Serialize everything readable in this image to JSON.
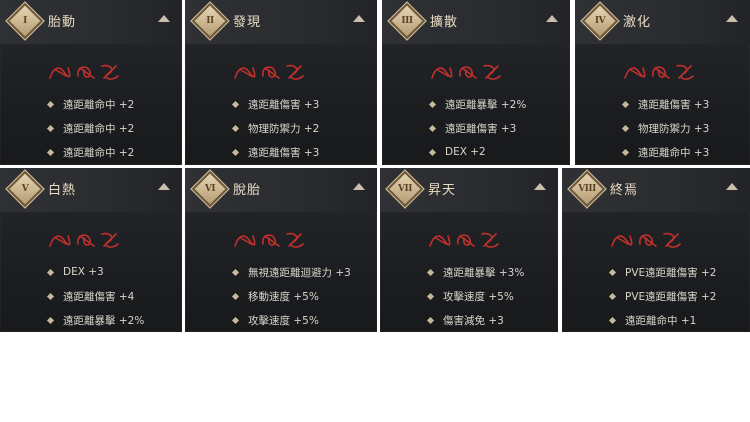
{
  "panels": [
    {
      "numeral": "I",
      "title": "胎動",
      "stats": [
        "遠距離命中 +2",
        "遠距離命中 +2",
        "遠距離命中 +2"
      ]
    },
    {
      "numeral": "II",
      "title": "發現",
      "stats": [
        "遠距離傷害 +3",
        "物理防禦力 +2",
        "遠距離傷害 +3"
      ]
    },
    {
      "numeral": "III",
      "title": "擴散",
      "stats": [
        "遠距離暴擊 +2%",
        "遠距離傷害 +3",
        "DEX +2"
      ]
    },
    {
      "numeral": "IV",
      "title": "激化",
      "stats": [
        "遠距離傷害 +3",
        "物理防禦力 +3",
        "遠距離命中 +3"
      ]
    },
    {
      "numeral": "V",
      "title": "白熱",
      "stats": [
        "DEX +3",
        "遠距離傷害 +4",
        "遠距離暴擊 +2%"
      ]
    },
    {
      "numeral": "VI",
      "title": "脫胎",
      "stats": [
        "無視遠距離迴避力 +3",
        "移動速度 +5%",
        "攻擊速度 +5%"
      ]
    },
    {
      "numeral": "VII",
      "title": "昇天",
      "stats": [
        "遠距離暴擊 +3%",
        "攻擊速度 +5%",
        "傷害減免 +3"
      ]
    },
    {
      "numeral": "VIII",
      "title": "終焉",
      "stats": [
        "PVE遠距離傷害 +2",
        "PVE遠距離傷害 +2",
        "遠距離命中 +1"
      ]
    }
  ],
  "colors": {
    "rune": "#c0302c",
    "title": "#e8dcc5",
    "text": "#d8d4cc",
    "badge": "#d9c59f"
  },
  "icons": {
    "badge": "diamond-numeral-badge",
    "collapse": "caret-up-icon",
    "bullet": "diamond-bullet-icon",
    "seal": "red-glyph-seal"
  }
}
